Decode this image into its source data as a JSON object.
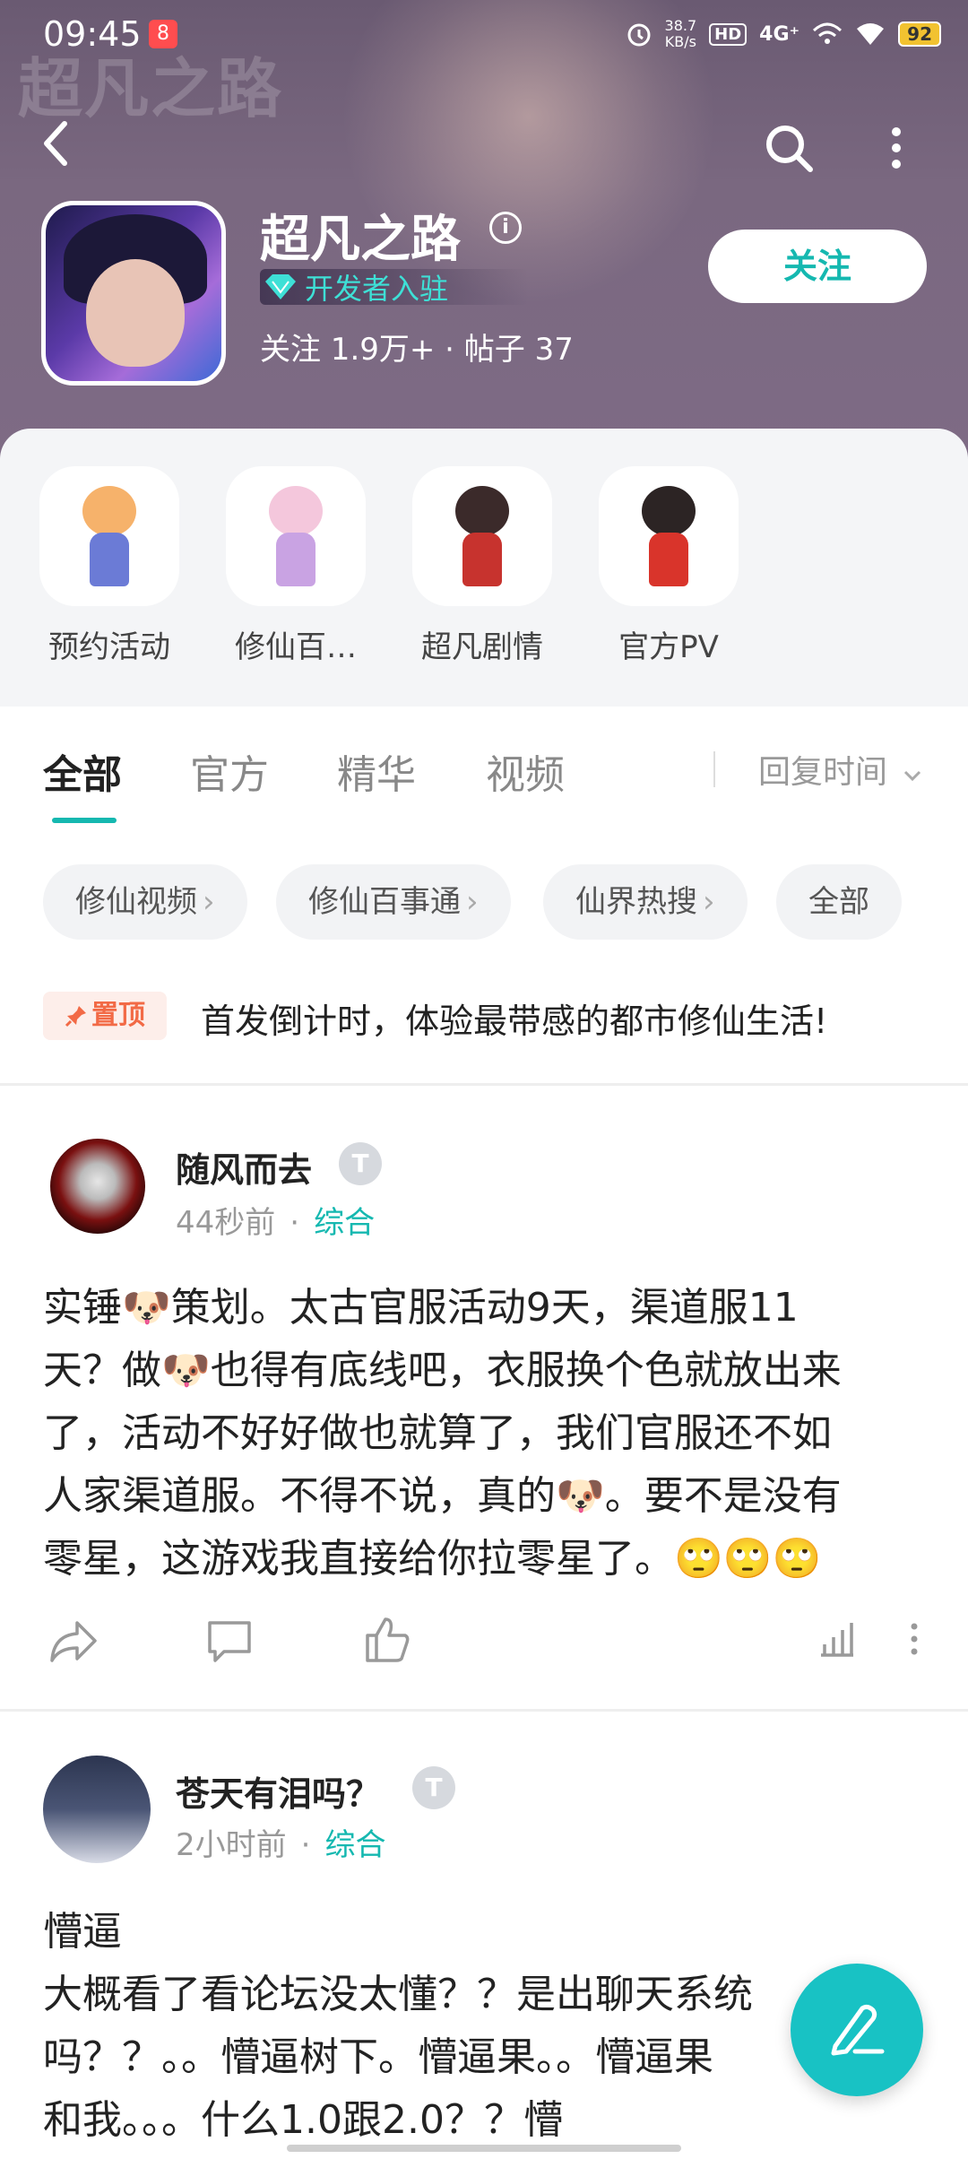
{
  "status_bar": {
    "time": "09:45",
    "app_badge": "8",
    "speed_value": "38.7",
    "speed_unit": "KB/s",
    "hd": "HD",
    "network": "4G⁺",
    "battery": "92"
  },
  "header": {
    "watermark": "超凡之路",
    "title": "超凡之路",
    "dev_badge": "开发者入驻",
    "stats": "关注 1.9万+ · 帖子 37",
    "follow_label": "关注"
  },
  "categories": [
    {
      "label": "预约活动",
      "icon": "chibi-girl-orange"
    },
    {
      "label": "修仙百…",
      "icon": "chibi-girl-pink"
    },
    {
      "label": "超凡剧情",
      "icon": "chibi-girl-red"
    },
    {
      "label": "官方PV",
      "icon": "chibi-girl-twintails"
    }
  ],
  "tabs": {
    "items": [
      "全部",
      "官方",
      "精华",
      "视频"
    ],
    "active": "全部",
    "sort_label": "回复时间"
  },
  "chips": [
    {
      "label": "修仙视频",
      "arrow": "›"
    },
    {
      "label": "修仙百事通",
      "arrow": "›"
    },
    {
      "label": "仙界热搜",
      "arrow": "›"
    },
    {
      "label": "全部",
      "arrow": ""
    }
  ],
  "pinned": {
    "tag": "置顶",
    "text": "首发倒计时，体验最带感的都市修仙生活!"
  },
  "posts": [
    {
      "user": "随风而去",
      "level": "T",
      "time": "44秒前",
      "dot": "·",
      "category": "综合",
      "lines": [
        "实锤🐶策划。太古官服活动9天，渠道服11",
        "天？做🐶也得有底线吧，衣服换个色就放出来",
        "了，活动不好好做也就算了，我们官服还不如",
        "人家渠道服。不得不说，真的🐶。要不是没有",
        "零星，这游戏我直接给你拉零星了。🙄🙄🙄"
      ]
    },
    {
      "user": "苍天有泪吗？",
      "level": "T",
      "time": "2小时前",
      "dot": "·",
      "category": "综合",
      "lines": [
        "懵逼",
        "大概看了看论坛没太懂？？是出聊天系统",
        "吗？？。。懵逼树下。懵逼果。。懵逼果",
        "和我。。。什么1.0跟2.0？？懵"
      ]
    }
  ],
  "colors": {
    "accent": "#15b8b0",
    "header_bg": "#7a6880",
    "pin": "#f26a46"
  }
}
